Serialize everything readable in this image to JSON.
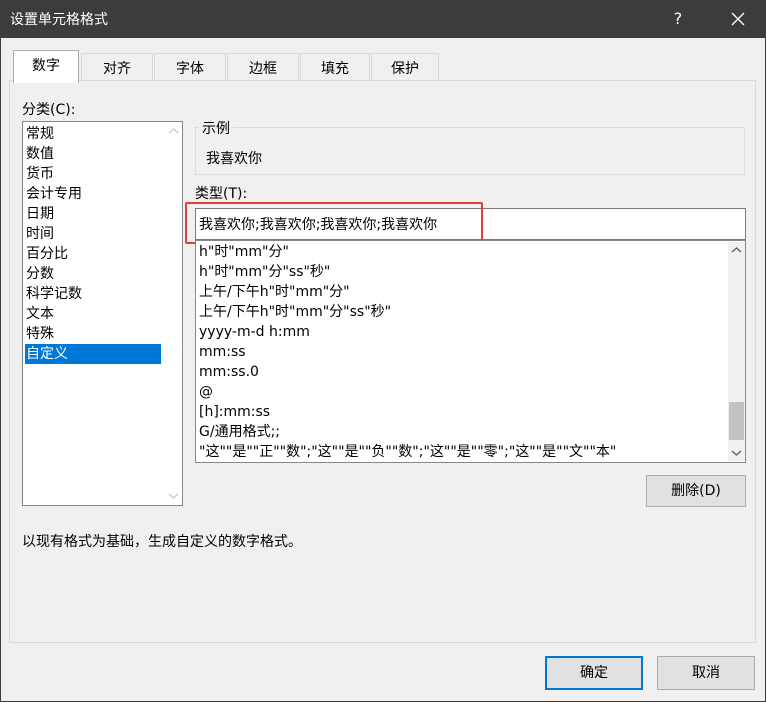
{
  "window": {
    "title": "设置单元格格式",
    "help_label": "?"
  },
  "tabs": [
    {
      "label": "数字",
      "active": true
    },
    {
      "label": "对齐"
    },
    {
      "label": "字体"
    },
    {
      "label": "边框"
    },
    {
      "label": "填充"
    },
    {
      "label": "保护"
    }
  ],
  "category": {
    "label": "分类(C):",
    "items": [
      "常规",
      "数值",
      "货币",
      "会计专用",
      "日期",
      "时间",
      "百分比",
      "分数",
      "科学记数",
      "文本",
      "特殊",
      "自定义"
    ],
    "selected": "自定义"
  },
  "sample": {
    "label": "示例",
    "value": "我喜欢你"
  },
  "type": {
    "label": "类型(T):",
    "value": "我喜欢你;我喜欢你;我喜欢你;我喜欢你",
    "formats": [
      "h\"时\"mm\"分\"",
      "h\"时\"mm\"分\"ss\"秒\"",
      "上午/下午h\"时\"mm\"分\"",
      "上午/下午h\"时\"mm\"分\"ss\"秒\"",
      "yyyy-m-d h:mm",
      "mm:ss",
      "mm:ss.0",
      "@",
      "[h]:mm:ss",
      "G/通用格式;;",
      "\"这\"\"是\"\"正\"\"数\";\"这\"\"是\"\"负\"\"数\";\"这\"\"是\"\"零\";\"这\"\"是\"\"文\"\"本\""
    ]
  },
  "delete_button": "删除(D)",
  "description": "以现有格式为基础，生成自定义的数字格式。",
  "ok_button": "确定",
  "cancel_button": "取消",
  "colors": {
    "accent": "#0078d7",
    "highlight": "#e33e3e",
    "dialog_bg": "#f0f0f0",
    "titlebar": "#3c3c3c"
  }
}
